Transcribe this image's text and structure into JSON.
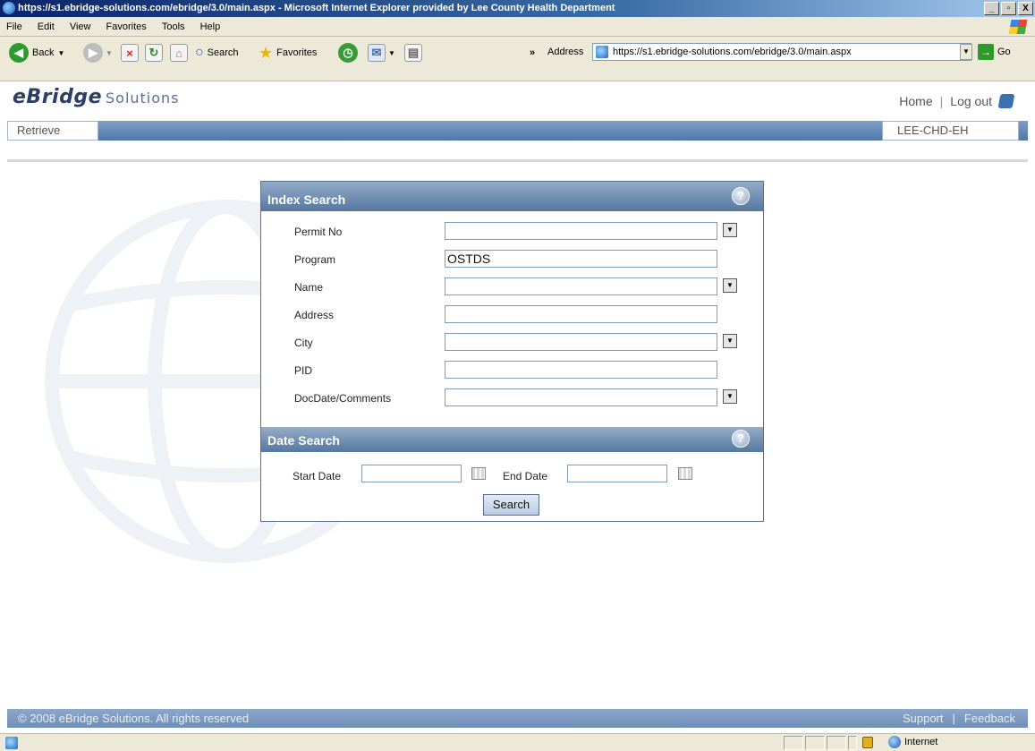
{
  "window": {
    "title": "https://s1.ebridge-solutions.com/ebridge/3.0/main.aspx - Microsoft Internet Explorer provided by Lee County Health Department",
    "min": "_",
    "max": "▫",
    "close": "X"
  },
  "menu": {
    "items": [
      "File",
      "Edit",
      "View",
      "Favorites",
      "Tools",
      "Help"
    ]
  },
  "toolbar": {
    "back": "Back",
    "search": "Search",
    "favorites": "Favorites",
    "chevron": "»",
    "address_label": "Address",
    "address_value": "https://s1.ebridge-solutions.com/ebridge/3.0/main.aspx",
    "go": "Go"
  },
  "header": {
    "brand": "eBridge",
    "brand_sub": "Solutions",
    "home": "Home",
    "sep": "|",
    "logout": "Log out"
  },
  "nav": {
    "tab": "Retrieve",
    "user": "LEE-CHD-EH"
  },
  "index_search": {
    "title": "Index Search",
    "help": "?",
    "fields": [
      {
        "label": "Permit No",
        "value": "",
        "dropdown": true
      },
      {
        "label": "Program",
        "value": "OSTDS",
        "dropdown": false
      },
      {
        "label": "Name",
        "value": "",
        "dropdown": true
      },
      {
        "label": "Address",
        "value": "",
        "dropdown": false
      },
      {
        "label": "City",
        "value": "",
        "dropdown": true
      },
      {
        "label": "PID",
        "value": "",
        "dropdown": false
      },
      {
        "label": "DocDate/Comments",
        "value": "",
        "dropdown": true
      }
    ]
  },
  "date_search": {
    "title": "Date Search",
    "help": "?",
    "start_label": "Start Date",
    "end_label": "End Date",
    "start_value": "",
    "end_value": ""
  },
  "search_button": "Search",
  "footer": {
    "copyright": "© 2008 eBridge Solutions. All rights reserved",
    "support": "Support",
    "sep": "|",
    "feedback": "Feedback"
  },
  "status": {
    "zone": "Internet"
  },
  "colors": {
    "nav": "#4f78a8",
    "panel_header": "#56779f",
    "footer": "#6f8fb8"
  }
}
